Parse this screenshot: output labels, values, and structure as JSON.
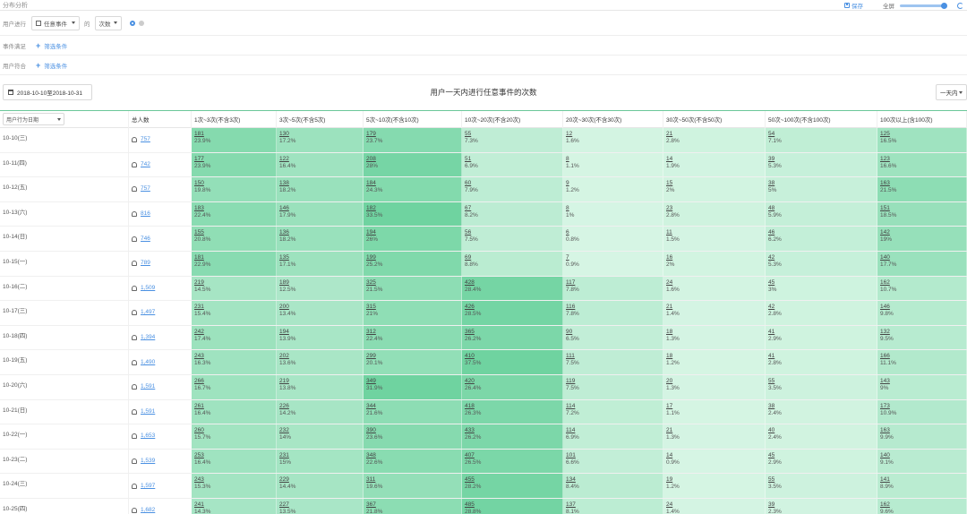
{
  "header": {
    "title": "分布分析",
    "save_label": "保存",
    "fullscreen_label": "全屏"
  },
  "filters": {
    "event_label": "用户进行",
    "event_value": "任意事件",
    "de": "的",
    "measure_value": "次数",
    "event_cond_label": "事件满足",
    "event_cond_add": "筛选条件",
    "user_cond_label": "用户符合",
    "user_cond_add": "筛选条件"
  },
  "toolbar": {
    "date_range": "2018-10-10至2018-10-31",
    "table_title": "用户一天内进行任意事件的次数",
    "period": "一天内"
  },
  "table": {
    "dimension_select": "用户行为日期",
    "headers": [
      "总人数",
      "1次~3次(不含3次)",
      "3次~5次(不含5次)",
      "5次~10次(不含10次)",
      "10次~20次(不含20次)",
      "20次~30次(不含30次)",
      "30次~50次(不含50次)",
      "50次~100次(不含100次)",
      "100次以上(含100次)"
    ],
    "rows": [
      {
        "date": "10-10(三)",
        "total": "757",
        "cells": [
          [
            "181",
            "23.9%"
          ],
          [
            "130",
            "17.2%"
          ],
          [
            "179",
            "23.7%"
          ],
          [
            "55",
            "7.3%"
          ],
          [
            "12",
            "1.6%"
          ],
          [
            "21",
            "2.8%"
          ],
          [
            "54",
            "7.1%"
          ],
          [
            "125",
            "16.5%"
          ]
        ]
      },
      {
        "date": "10-11(四)",
        "total": "742",
        "cells": [
          [
            "177",
            "23.9%"
          ],
          [
            "122",
            "16.4%"
          ],
          [
            "208",
            "28%"
          ],
          [
            "51",
            "6.9%"
          ],
          [
            "8",
            "1.1%"
          ],
          [
            "14",
            "1.9%"
          ],
          [
            "39",
            "5.3%"
          ],
          [
            "123",
            "16.6%"
          ]
        ]
      },
      {
        "date": "10-12(五)",
        "total": "757",
        "cells": [
          [
            "150",
            "19.8%"
          ],
          [
            "138",
            "18.2%"
          ],
          [
            "184",
            "24.3%"
          ],
          [
            "60",
            "7.9%"
          ],
          [
            "9",
            "1.2%"
          ],
          [
            "15",
            "2%"
          ],
          [
            "38",
            "5%"
          ],
          [
            "163",
            "21.5%"
          ]
        ]
      },
      {
        "date": "10-13(六)",
        "total": "816",
        "cells": [
          [
            "183",
            "22.4%"
          ],
          [
            "146",
            "17.9%"
          ],
          [
            "182",
            "33.5%"
          ],
          [
            "67",
            "8.2%"
          ],
          [
            "8",
            "1%"
          ],
          [
            "23",
            "2.8%"
          ],
          [
            "48",
            "5.9%"
          ],
          [
            "151",
            "18.5%"
          ]
        ]
      },
      {
        "date": "10-14(日)",
        "total": "746",
        "cells": [
          [
            "155",
            "20.8%"
          ],
          [
            "136",
            "18.2%"
          ],
          [
            "194",
            "26%"
          ],
          [
            "56",
            "7.5%"
          ],
          [
            "6",
            "0.8%"
          ],
          [
            "11",
            "1.5%"
          ],
          [
            "46",
            "6.2%"
          ],
          [
            "142",
            "19%"
          ]
        ]
      },
      {
        "date": "10-15(一)",
        "total": "789",
        "cells": [
          [
            "181",
            "22.9%"
          ],
          [
            "135",
            "17.1%"
          ],
          [
            "199",
            "25.2%"
          ],
          [
            "69",
            "8.8%"
          ],
          [
            "7",
            "0.9%"
          ],
          [
            "16",
            "2%"
          ],
          [
            "42",
            "5.3%"
          ],
          [
            "140",
            "17.7%"
          ]
        ]
      },
      {
        "date": "10-16(二)",
        "total": "1,509",
        "cells": [
          [
            "219",
            "14.5%"
          ],
          [
            "189",
            "12.5%"
          ],
          [
            "325",
            "21.5%"
          ],
          [
            "428",
            "28.4%"
          ],
          [
            "117",
            "7.8%"
          ],
          [
            "24",
            "1.6%"
          ],
          [
            "45",
            "3%"
          ],
          [
            "162",
            "10.7%"
          ]
        ]
      },
      {
        "date": "10-17(三)",
        "total": "1,497",
        "cells": [
          [
            "231",
            "15.4%"
          ],
          [
            "200",
            "13.4%"
          ],
          [
            "315",
            "21%"
          ],
          [
            "426",
            "28.5%"
          ],
          [
            "116",
            "7.8%"
          ],
          [
            "21",
            "1.4%"
          ],
          [
            "42",
            "2.8%"
          ],
          [
            "146",
            "9.8%"
          ]
        ]
      },
      {
        "date": "10-18(四)",
        "total": "1,394",
        "cells": [
          [
            "242",
            "17.4%"
          ],
          [
            "194",
            "13.9%"
          ],
          [
            "312",
            "22.4%"
          ],
          [
            "365",
            "26.2%"
          ],
          [
            "90",
            "6.5%"
          ],
          [
            "18",
            "1.3%"
          ],
          [
            "41",
            "2.9%"
          ],
          [
            "132",
            "9.5%"
          ]
        ]
      },
      {
        "date": "10-19(五)",
        "total": "1,490",
        "cells": [
          [
            "243",
            "16.3%"
          ],
          [
            "202",
            "13.6%"
          ],
          [
            "299",
            "20.1%"
          ],
          [
            "410",
            "37.5%"
          ],
          [
            "111",
            "7.5%"
          ],
          [
            "18",
            "1.2%"
          ],
          [
            "41",
            "2.8%"
          ],
          [
            "166",
            "11.1%"
          ]
        ]
      },
      {
        "date": "10-20(六)",
        "total": "1,591",
        "cells": [
          [
            "266",
            "16.7%"
          ],
          [
            "219",
            "13.8%"
          ],
          [
            "349",
            "31.9%"
          ],
          [
            "420",
            "26.4%"
          ],
          [
            "119",
            "7.5%"
          ],
          [
            "20",
            "1.3%"
          ],
          [
            "55",
            "3.5%"
          ],
          [
            "143",
            "9%"
          ]
        ]
      },
      {
        "date": "10-21(日)",
        "total": "1,591",
        "cells": [
          [
            "261",
            "16.4%"
          ],
          [
            "226",
            "14.2%"
          ],
          [
            "344",
            "21.6%"
          ],
          [
            "418",
            "26.3%"
          ],
          [
            "114",
            "7.2%"
          ],
          [
            "17",
            "1.1%"
          ],
          [
            "38",
            "2.4%"
          ],
          [
            "173",
            "10.9%"
          ]
        ]
      },
      {
        "date": "10-22(一)",
        "total": "1,653",
        "cells": [
          [
            "260",
            "15.7%"
          ],
          [
            "232",
            "14%"
          ],
          [
            "390",
            "23.6%"
          ],
          [
            "433",
            "26.2%"
          ],
          [
            "114",
            "6.9%"
          ],
          [
            "21",
            "1.3%"
          ],
          [
            "40",
            "2.4%"
          ],
          [
            "163",
            "9.9%"
          ]
        ]
      },
      {
        "date": "10-23(二)",
        "total": "1,539",
        "cells": [
          [
            "253",
            "16.4%"
          ],
          [
            "231",
            "15%"
          ],
          [
            "348",
            "22.6%"
          ],
          [
            "407",
            "26.5%"
          ],
          [
            "101",
            "6.6%"
          ],
          [
            "14",
            "0.9%"
          ],
          [
            "45",
            "2.9%"
          ],
          [
            "140",
            "9.1%"
          ]
        ]
      },
      {
        "date": "10-24(三)",
        "total": "1,597",
        "cells": [
          [
            "243",
            "15.3%"
          ],
          [
            "229",
            "14.4%"
          ],
          [
            "311",
            "19.6%"
          ],
          [
            "455",
            "28.2%"
          ],
          [
            "134",
            "8.4%"
          ],
          [
            "19",
            "1.2%"
          ],
          [
            "55",
            "3.5%"
          ],
          [
            "141",
            "8.9%"
          ]
        ]
      },
      {
        "date": "10-25(四)",
        "total": "1,682",
        "cells": [
          [
            "241",
            "14.3%"
          ],
          [
            "227",
            "13.5%"
          ],
          [
            "367",
            "21.8%"
          ],
          [
            "485",
            "28.8%"
          ],
          [
            "137",
            "8.1%"
          ],
          [
            "24",
            "1.4%"
          ],
          [
            "39",
            "2.3%"
          ],
          [
            "162",
            "9.6%"
          ]
        ]
      }
    ]
  },
  "colors": {
    "accent": "#4a90e2",
    "heat_base": "#d9f6e6",
    "heat_max": "#6fd3a0"
  }
}
